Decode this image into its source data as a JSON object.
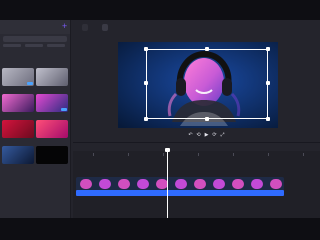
{
  "colors": {
    "accent": "#7c5cff",
    "audio_track": "#2f6bff",
    "badge": "#4aa3ff"
  },
  "media_panel": {
    "title": "",
    "add_icon": "plus-icon"
  },
  "preview": {
    "tabs": [
      "",
      ""
    ],
    "controls": {
      "undo_icon": "undo-icon",
      "play_icon": "play-icon",
      "fullscreen_icon": "fullscreen-icon"
    }
  },
  "timeline": {
    "timecode": ""
  }
}
